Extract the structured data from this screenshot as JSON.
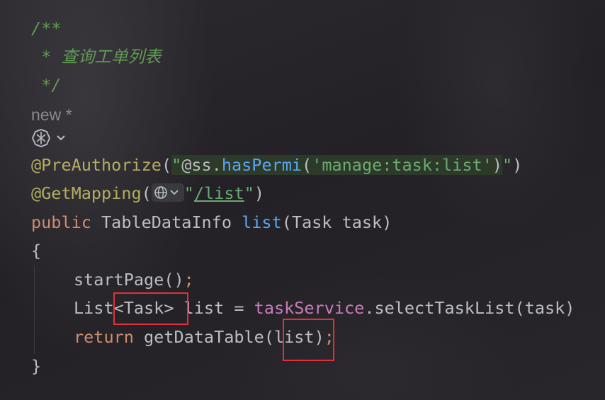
{
  "editor": {
    "comment_open": "/**",
    "comment_star": " * ",
    "comment_text": "查询工单列表",
    "comment_close": " */",
    "hint_text": "new *",
    "ai_icon_name": "ai-assistant-icon",
    "preauth": {
      "annotation": "@PreAuthorize",
      "paren_open": "(",
      "q1": "\"",
      "at": "@",
      "ss": "ss",
      "dot": ".",
      "method": "hasPermi",
      "arg_open": "(",
      "arg": "'manage:task:list'",
      "arg_close": ")",
      "q2": "\"",
      "paren_close": ")"
    },
    "getmapping": {
      "annotation": "@GetMapping",
      "paren_open": "(",
      "q1": "\"",
      "path": "/list",
      "q2": "\"",
      "paren_close": ")"
    },
    "signature": {
      "kw_public": "public",
      "return_type": " TableDataInfo ",
      "method": "list",
      "params": "(Task task)"
    },
    "brace_open": "{",
    "start_page": {
      "call": "startPage",
      "parens": "()",
      "semi": ";"
    },
    "list_decl": {
      "type": "List",
      "generic": "<Task>",
      "rest": " list = ",
      "service": "taskService",
      "call": ".selectTaskList(task)"
    },
    "return_stmt": {
      "kw_return": "return",
      "call": " getDataTable(",
      "arg": "list",
      "close": ")",
      "semi": ";"
    },
    "brace_close": "}"
  },
  "highlights": {
    "box_color": "#e0303a",
    "boxes": [
      "generic-type-highlight",
      "return-arg-highlight"
    ]
  }
}
